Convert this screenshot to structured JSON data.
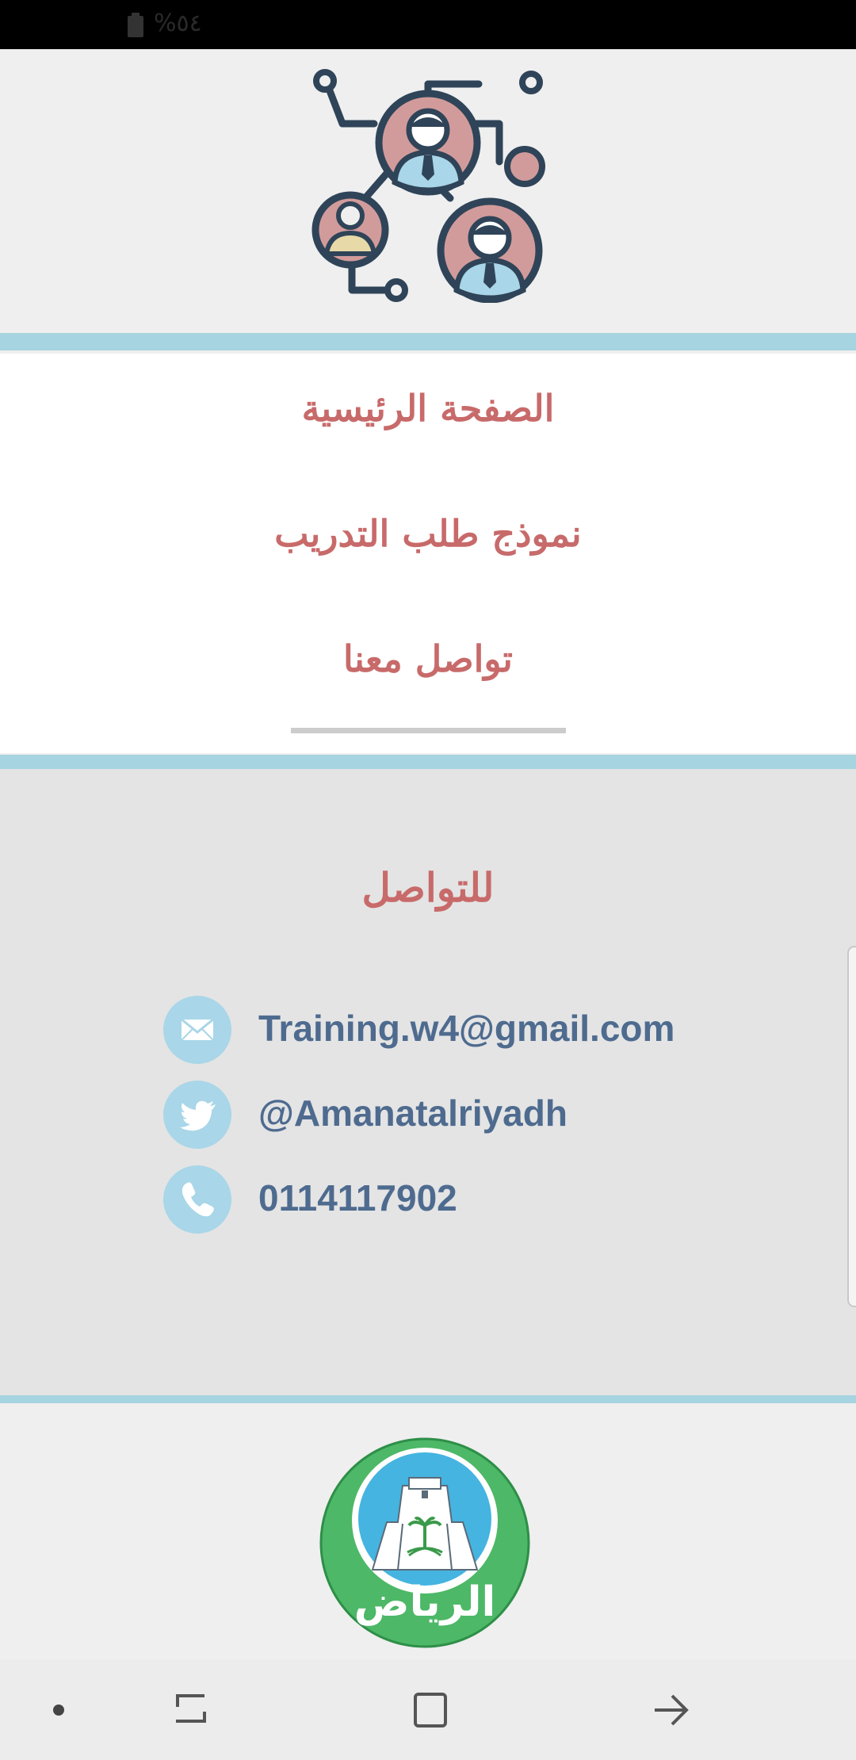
{
  "status_bar": {
    "battery_text": "%٥٤"
  },
  "header": {
    "illustration": "team-network-illustration"
  },
  "nav": {
    "items": [
      {
        "label": "الصفحة الرئيسية"
      },
      {
        "label": "نموذج طلب التدريب"
      },
      {
        "label": "تواصل معنا"
      }
    ]
  },
  "contact": {
    "title": "للتواصل",
    "email": "Training.w4@gmail.com",
    "twitter": "@Amanatalriyadh",
    "phone": "0114117902"
  },
  "footer": {
    "logo_text": "الرياض"
  },
  "system_nav": {
    "icons": [
      "dot-icon",
      "recent-apps-icon",
      "home-icon",
      "back-icon"
    ]
  },
  "colors": {
    "accent_band": "#a6d4e0",
    "nav_text": "#c86a6a",
    "contact_text": "#4e6b8f",
    "icon_circle": "#a9d6e8",
    "logo_green": "#4db867"
  }
}
